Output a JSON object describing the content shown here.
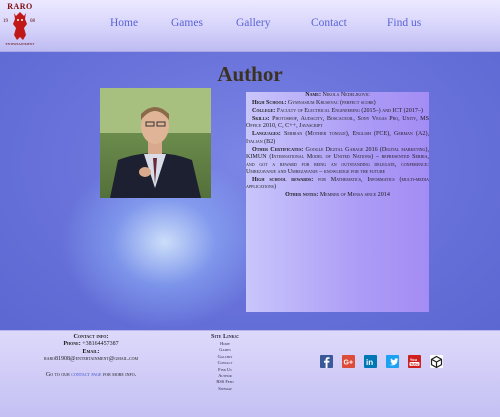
{
  "logo": {
    "text": "RARO",
    "year_left": "19",
    "year_right": "08",
    "subtitle": "ENTERTAINMENT"
  },
  "nav": [
    {
      "label": "Home"
    },
    {
      "label": "Games"
    },
    {
      "label": "Gallery"
    },
    {
      "label": "Contact"
    },
    {
      "label": "Find us"
    }
  ],
  "main": {
    "title": "Author",
    "entries": [
      {
        "label": "Name:",
        "value": "Nikola Nedeljkovic"
      },
      {
        "label": "High School:",
        "value": "Gymnasium Krusevac (perfect score)"
      },
      {
        "label": "College:",
        "value": "Faculty of Electrical Engineering (2015–) and ICT (2017–)"
      },
      {
        "label": "Skills:",
        "value": "Photoshop, Audacity, Boscaceoil, Sony Vegas Pro, Unity, MS Office 2010, C, C++, Javascript"
      },
      {
        "label": "Languages:",
        "value": "Serbian (Mother tongue), English (FCE), German (A2), Italian (B2)"
      },
      {
        "label": "Other Certificates:",
        "value": "Google Digital Garage 2016 (Digital marketing), KIMUN (International Model of United Nations) – represented Serbia, and got a reward for being an outstanding delegate, conference: Umrezavanje and Umrezavanje – knowledge for the future"
      },
      {
        "label": "High school rewards:",
        "value": "for Mathematics, Informatics (multi-media applications)"
      },
      {
        "label": "Other notes:",
        "value": "Member of Mensa since 2014"
      }
    ]
  },
  "footer": {
    "contact_title": "Contact info:",
    "phone_label": "Phone:",
    "phone_value": "+38164457387",
    "email_label": "Email:",
    "email_value": "raro81908@entertainment@gmail.com",
    "goto_prefix": "Go to our",
    "goto_link": "contact page",
    "goto_suffix": "for more info.",
    "links_title": "Site Links:",
    "links": [
      "Home",
      "Games",
      "Gallery",
      "Contact",
      "Find Us",
      "Author",
      "RSS Feed",
      "Sitemap"
    ],
    "social": [
      {
        "icon": "facebook-icon",
        "color": "#3b5998"
      },
      {
        "icon": "google-plus-icon",
        "color": "#dd4b39"
      },
      {
        "icon": "linkedin-icon",
        "color": "#0077b5"
      },
      {
        "icon": "twitter-icon",
        "color": "#1da1f2"
      },
      {
        "icon": "youtube-icon",
        "color": "#cd201f"
      },
      {
        "icon": "unity-icon",
        "color": "#222222"
      }
    ]
  }
}
